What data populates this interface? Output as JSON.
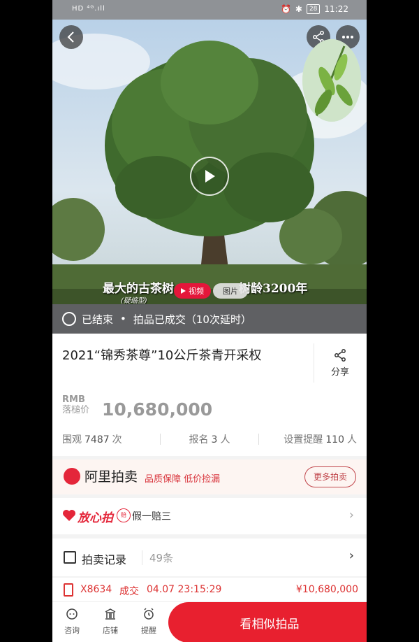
{
  "status_bar": {
    "left": "HD ⁴ᴳ.ıll",
    "battery": "28",
    "time": "11:22"
  },
  "hero": {
    "caption_left": "最大的古茶树",
    "caption_sub": "(疑缩型)",
    "caption_right": "树龄3200年",
    "video_label": "视频",
    "photo_label": "图片"
  },
  "status": {
    "ended": "已结束",
    "result": "拍品已成交（10次延时）"
  },
  "item": {
    "title": "2021“锦秀茶尊”10公斤茶青开采权",
    "share_label": "分享",
    "currency": "RMB",
    "price_label": "落槌价",
    "price": "10,680,000"
  },
  "stats": [
    {
      "label": "围观",
      "value": "7487",
      "unit": "次"
    },
    {
      "label": "报名",
      "value": "3",
      "unit": "人"
    },
    {
      "label": "设置提醒",
      "value": "110",
      "unit": "人"
    }
  ],
  "ali": {
    "name": "阿里拍卖",
    "tagline": "品质保障 低价捡漏",
    "more": "更多拍卖"
  },
  "fangxinpai": {
    "name": "放心拍",
    "badge": "赔",
    "text": "假一赔三"
  },
  "records": {
    "title": "拍卖记录",
    "count": "49条"
  },
  "latest_bid": {
    "bidder": "X8634",
    "status": "成交",
    "time": "04.07 23:15:29",
    "amount": "¥10,680,000"
  },
  "bottom_nav": [
    {
      "label": "咨询",
      "icon": "chat-icon"
    },
    {
      "label": "店铺",
      "icon": "store-icon"
    },
    {
      "label": "提醒",
      "icon": "alarm-icon"
    }
  ],
  "cta": "看相似拍品"
}
